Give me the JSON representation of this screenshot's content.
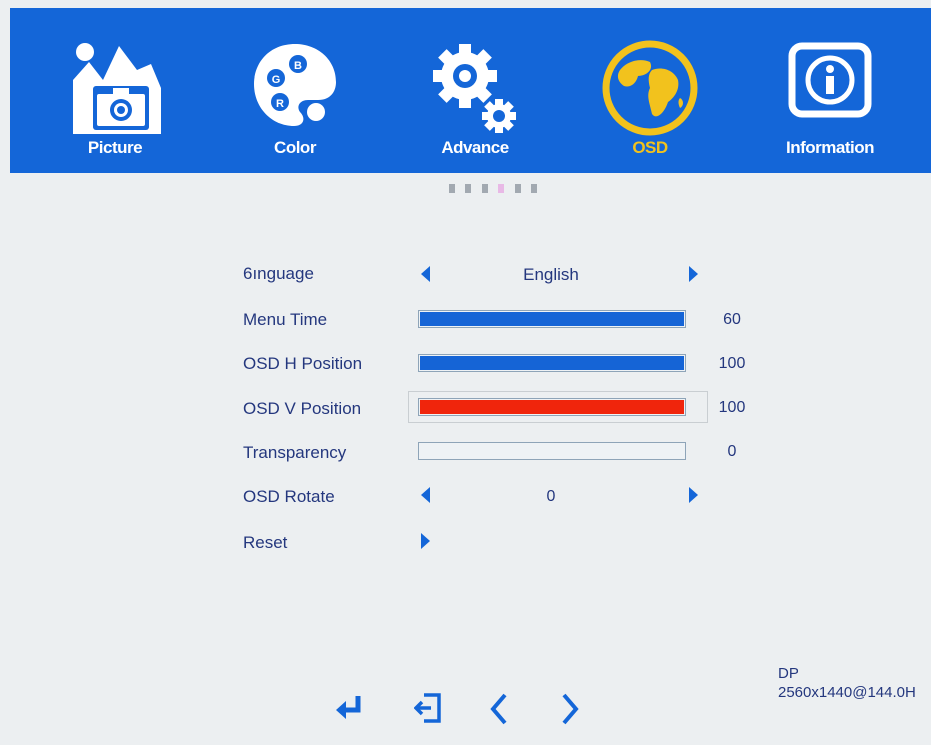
{
  "tabs": [
    {
      "label": "Picture",
      "icon": "picture-icon"
    },
    {
      "label": "Color",
      "icon": "color-palette-icon"
    },
    {
      "label": "Advance",
      "icon": "gears-icon"
    },
    {
      "label": "OSD",
      "icon": "globe-icon",
      "active": true
    },
    {
      "label": "Information",
      "icon": "information-icon"
    }
  ],
  "page_indicator": {
    "count": 6,
    "active_index": 3
  },
  "menu": {
    "language": {
      "label": "6ınguage",
      "value": "English"
    },
    "menu_time": {
      "label": "Menu Time",
      "value": "60",
      "level_percent": 100
    },
    "osd_h_position": {
      "label": "OSD H Position",
      "value": "100",
      "level_percent": 100
    },
    "osd_v_position": {
      "label": "OSD V Position",
      "value": "100",
      "level_percent": 100,
      "selected": true
    },
    "transparency": {
      "label": "Transparency",
      "value": "0",
      "level_percent": 0
    },
    "osd_rotate": {
      "label": "OSD Rotate",
      "value": "0"
    },
    "reset": {
      "label": "Reset"
    }
  },
  "nav_icons": [
    "enter-icon",
    "exit-icon",
    "chevron-left-icon",
    "chevron-right-icon"
  ],
  "signal": {
    "input": "DP",
    "mode": "2560x1440@144.0H"
  },
  "colors": {
    "bar_blue": "#1466d8",
    "selected_bar": "#f0250c",
    "active_tab_label": "#f2c21d"
  }
}
